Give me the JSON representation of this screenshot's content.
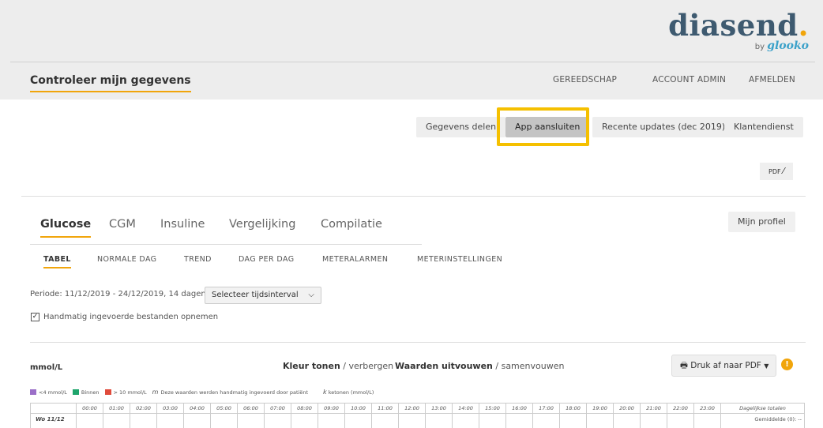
{
  "logo": {
    "name": "diasend",
    "dot": ".",
    "by": "by",
    "sub_brand": "glooko"
  },
  "header": {
    "title": "Controleer mijn gegevens",
    "nav": [
      "GEREEDSCHAP",
      "ACCOUNT ADMIN",
      "AFMELDEN"
    ]
  },
  "actions": {
    "share": "Gegevens delen",
    "connect_app": "App aansluiten",
    "updates": "Recente updates (dec 2019)",
    "support": "Klantendienst",
    "pdf": "PDF"
  },
  "profile_button": "Mijn profiel",
  "tabs": [
    "Glucose",
    "CGM",
    "Insuline",
    "Vergelijking",
    "Compilatie"
  ],
  "subtabs": [
    "TABEL",
    "NORMALE DAG",
    "TREND",
    "DAG PER DAG",
    "METERALARMEN",
    "METERINSTELLINGEN"
  ],
  "period": {
    "text": "Periode: 11/12/2019 - 24/12/2019, 14 dagen",
    "select": "Selecteer tijdsinterval"
  },
  "checkbox_label": "Handmatig ingevoerde bestanden opnemen",
  "table_controls": {
    "unit": "mmol/L",
    "kleur_bold": "Kleur tonen",
    "kleur_rest": " / verbergen",
    "waarden_bold": "Waarden uitvouwen",
    "waarden_rest": " / samenvouwen",
    "print": "Druk af naar PDF",
    "warning": "!"
  },
  "legend": {
    "low": "<4 mmol/L",
    "in": "Binnen",
    "high": "> 10 mmol/L",
    "manual_symbol": "m",
    "manual": "Deze waarden werden handmatig ingevoerd door patiënt",
    "ketone_symbol": "k",
    "ketone": "ketonen (mmol/L)",
    "colors": {
      "low": "#9b6fc8",
      "in": "#1fa56c",
      "high": "#e04b3c"
    }
  },
  "grid": {
    "hours": [
      "00:00",
      "01:00",
      "02:00",
      "03:00",
      "04:00",
      "05:00",
      "06:00",
      "07:00",
      "08:00",
      "09:00",
      "10:00",
      "11:00",
      "12:00",
      "13:00",
      "14:00",
      "15:00",
      "16:00",
      "17:00",
      "18:00",
      "19:00",
      "20:00",
      "21:00",
      "22:00",
      "23:00"
    ],
    "totals_header": "Dagelijkse totalen",
    "first_day": "Wo 11/12",
    "first_total": "Gemiddelde (0): --"
  }
}
